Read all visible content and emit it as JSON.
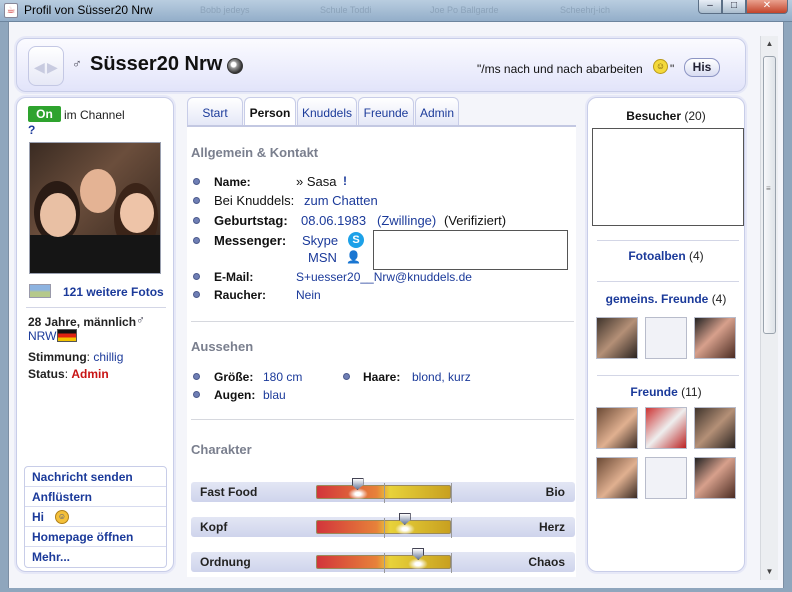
{
  "window": {
    "title": "Profil von Süsser20 Nrw",
    "ghost_tabs": [
      "Bobb jedeys",
      "Schule Toddi",
      "Joe Po Ballgarde",
      "Scheehrj-ich"
    ],
    "controls": {
      "minimize": "–",
      "maximize": "□",
      "close": "✕"
    }
  },
  "header": {
    "gender_symbol": "♂",
    "name": "Süsser20 Nrw",
    "motto": "\"/ms nach und nach abarbeiten",
    "motto_end": "\"",
    "his_button": "His"
  },
  "left": {
    "status_badge": "On",
    "status_text": "im Channel",
    "help": "?",
    "more_photos": "121 weitere Fotos",
    "age_gender": "28 Jahre, männlich",
    "region": "NRW",
    "mood_label": "Stimmung",
    "mood_value": "chillig",
    "status_label": "Status",
    "status_value": "Admin",
    "colon": ":",
    "actions": [
      "Nachricht senden",
      "Anflüstern",
      "Hi",
      "Homepage öffnen",
      "Mehr..."
    ]
  },
  "tabs": [
    "Start",
    "Person",
    "Knuddels",
    "Freunde",
    "Admin"
  ],
  "active_tab": "Person",
  "person": {
    "section_contact": "Allgemein & Kontakt",
    "name_label": "Name:",
    "name_value": "» Sasa",
    "name_mark": "!",
    "knuddels_line": "Bei Knuddels:",
    "knuddels_value": "zum Chatten",
    "birthday_label": "Geburtstag:",
    "birthday_value": "08.06.1983",
    "birthday_sign": "(Zwillinge)",
    "birthday_verified": "(Verifiziert)",
    "messenger_label": "Messenger:",
    "messenger_skype": "Skype",
    "messenger_msn": "MSN",
    "email_label": "E-Mail:",
    "email_value": "S+uesser20__Nrw@knuddels.de",
    "smoker_label": "Raucher:",
    "smoker_value": "Nein",
    "section_looks": "Aussehen",
    "height_label": "Größe:",
    "height_value": "180 cm",
    "hair_label": "Haare:",
    "hair_value": "blond, kurz",
    "eyes_label": "Augen:",
    "eyes_value": "blau",
    "section_character": "Charakter",
    "traits": [
      {
        "left": "Fast Food",
        "right": "Bio",
        "level": 0.3
      },
      {
        "left": "Kopf",
        "right": "Herz",
        "level": 0.65
      },
      {
        "left": "Ordnung",
        "right": "Chaos",
        "level": 0.75
      }
    ]
  },
  "right": {
    "visitors_label": "Besucher",
    "visitors_count": "(20)",
    "albums_label": "Fotoalben",
    "albums_count": "(4)",
    "mutual_label": "gemeins. Freunde",
    "mutual_count": "(4)",
    "friends_label": "Freunde",
    "friends_count": "(11)"
  },
  "icons": {
    "nav_left": "left-arrow-icon",
    "nav_right": "right-arrow-icon",
    "gender": "male-icon",
    "soccer": "soccer-ball-icon",
    "smiley": "smiley-icon",
    "skype": "skype-icon",
    "msn": "msn-icon",
    "flag": "germany-flag-icon"
  },
  "colors": {
    "online": "#2ea32e",
    "link": "#1b3a9a",
    "admin": "#c81414"
  }
}
